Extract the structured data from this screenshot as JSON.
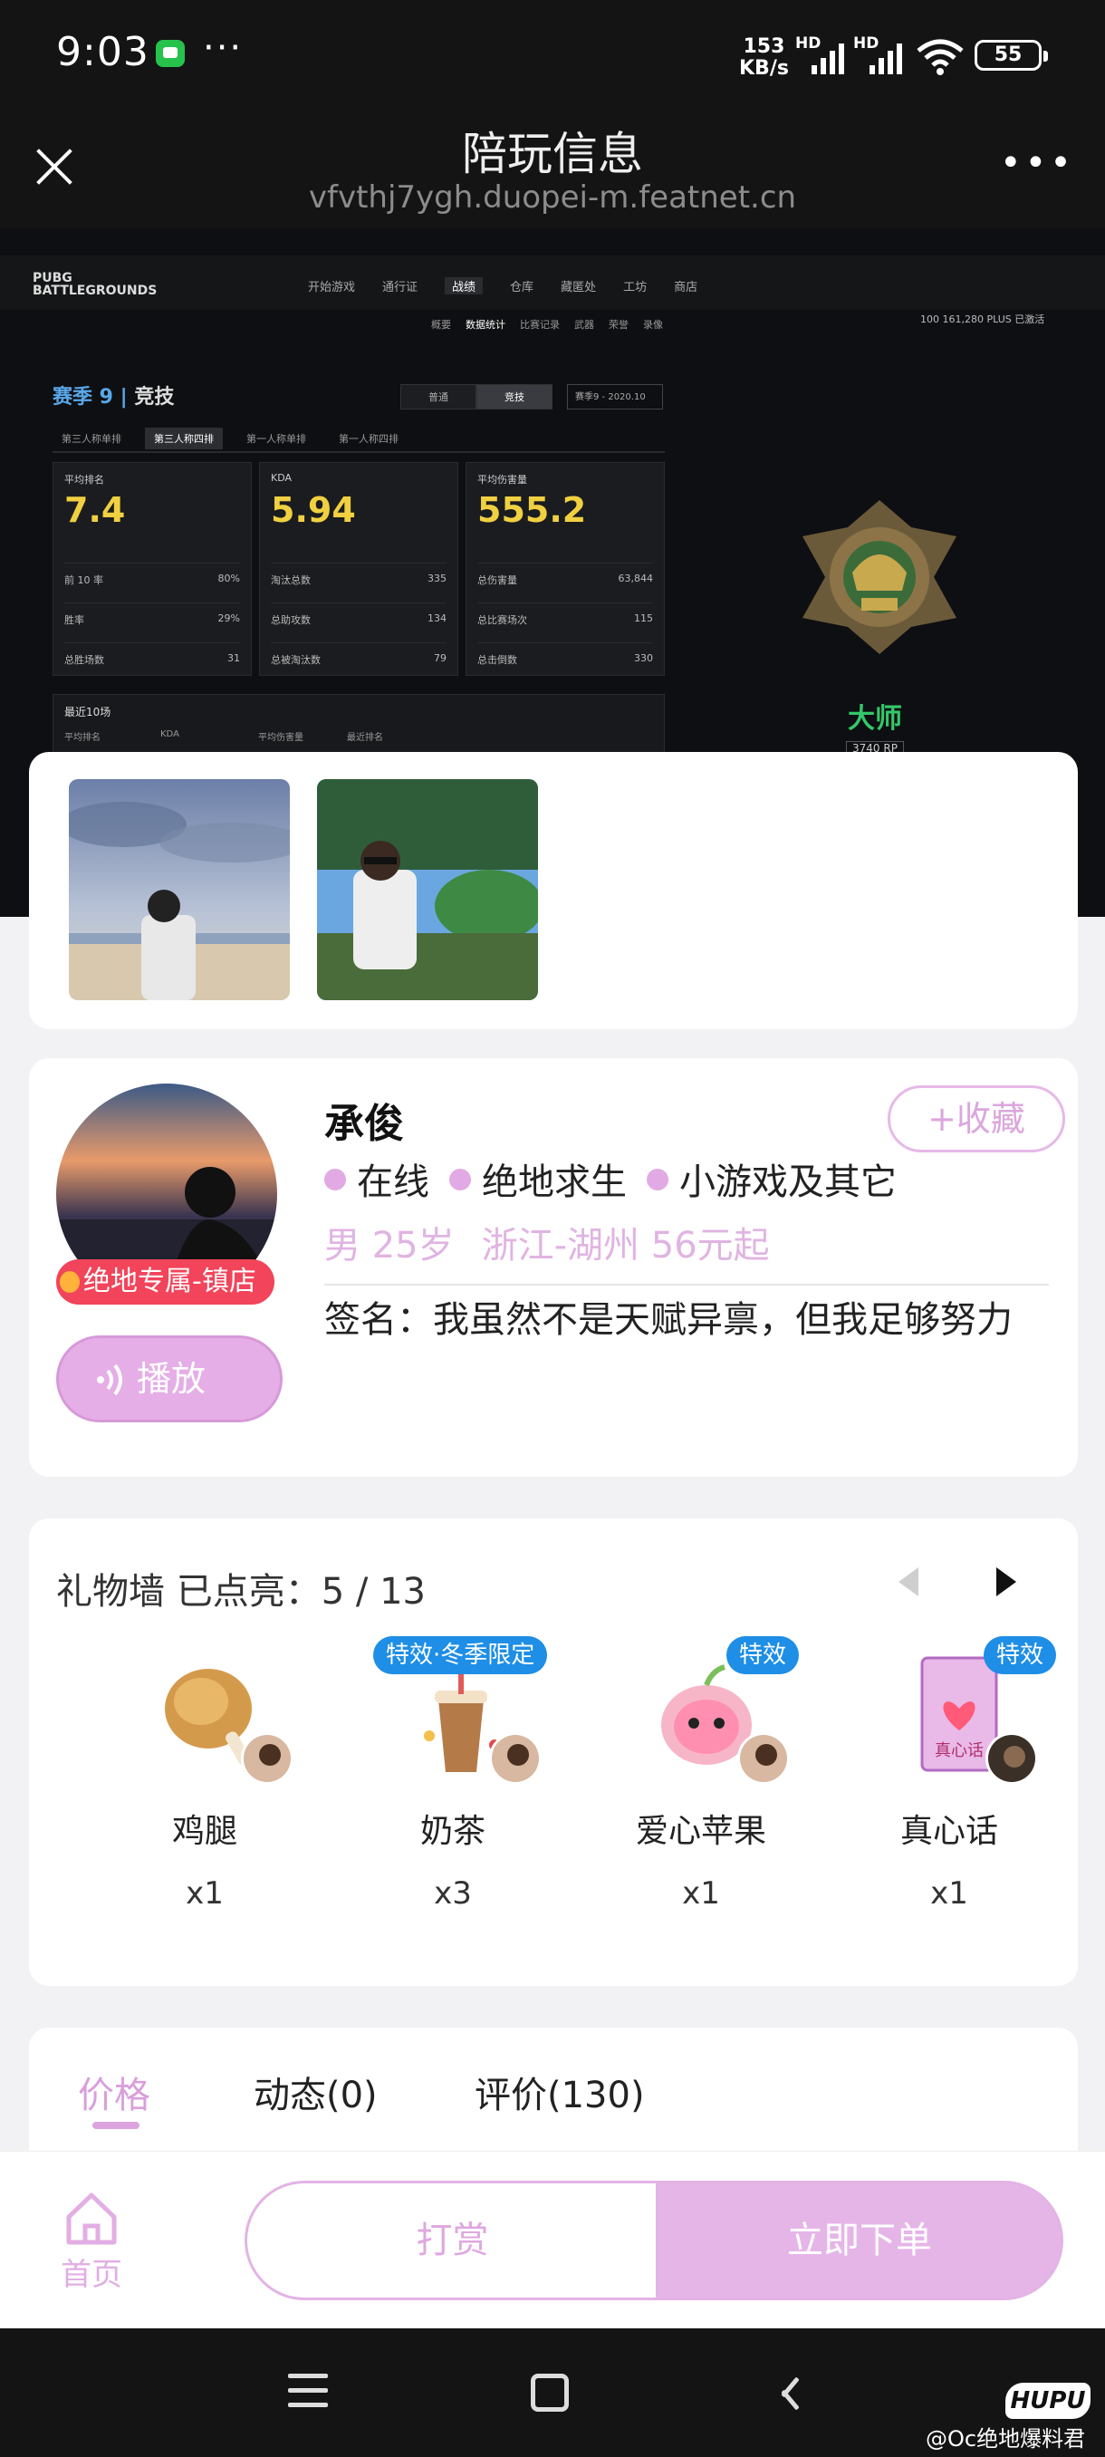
{
  "status_bar": {
    "time": "9:03",
    "net_speed_value": "153",
    "net_speed_unit": "KB/s",
    "signal_label": "HD",
    "battery": "55"
  },
  "header": {
    "title": "陪玩信息",
    "url": "vfvthj7ygh.duopei-m.featnet.cn"
  },
  "banner": {
    "logo_top": "PUBG",
    "logo_bottom": "BATTLEGROUNDS",
    "nav": [
      "开始游戏",
      "通行证",
      "战绩",
      "仓库",
      "藏匿处",
      "工坊",
      "商店"
    ],
    "nav_selected": 2,
    "subnav": [
      "概要",
      "数据统计",
      "比赛记录",
      "武器",
      "荣誉",
      "录像"
    ],
    "subnav_selected": 1,
    "currency": "100   161,280   PLUS   已激活",
    "season": "赛季 9",
    "season_mode": "竞技",
    "mode_normal": "普通",
    "mode_ranked": "竞技",
    "season_select": "赛季9 - 2020.10",
    "perspective_tabs": [
      "第三人称单排",
      "第三人称四排",
      "第一人称单排",
      "第一人称四排"
    ],
    "perspective_selected": 1,
    "cards": [
      {
        "label": "平均排名",
        "value": "7.4",
        "rows": [
          [
            "前 10 率",
            "80%"
          ],
          [
            "胜率",
            "29%"
          ],
          [
            "总胜场数",
            "31"
          ]
        ]
      },
      {
        "label": "KDA",
        "value": "5.94",
        "rows": [
          [
            "淘汰总数",
            "335"
          ],
          [
            "总助攻数",
            "134"
          ],
          [
            "总被淘汰数",
            "79"
          ]
        ]
      },
      {
        "label": "平均伤害量",
        "value": "555.2",
        "rows": [
          [
            "总伤害量",
            "63,844"
          ],
          [
            "总比赛场次",
            "115"
          ],
          [
            "总击倒数",
            "330"
          ]
        ]
      }
    ],
    "recent_title": "最近10场",
    "recent_headers": [
      "平均排名",
      "KDA",
      "平均伤害量",
      "最近排名"
    ],
    "rank_name": "大师",
    "rank_points": "3740",
    "rank_tier": "RP"
  },
  "profile": {
    "name": "承俊",
    "collect_label": "+收藏",
    "badge": "绝地专属-镇店",
    "play_label": "播放",
    "tags": [
      "在线",
      "绝地求生",
      "小游戏及其它"
    ],
    "gender": "男",
    "age": "25岁",
    "location": "浙江-湖州",
    "price": "56元起",
    "signature": "签名：我虽然不是天赋异禀，但我足够努力"
  },
  "gift_wall": {
    "title": "礼物墙 已点亮：5 / 13",
    "items": [
      {
        "name": "鸡腿",
        "count": "x1",
        "tag": ""
      },
      {
        "name": "奶茶",
        "count": "x3",
        "tag": "特效·冬季限定"
      },
      {
        "name": "爱心苹果",
        "count": "x1",
        "tag": "特效"
      },
      {
        "name": "真心话",
        "count": "x1",
        "tag": "特效",
        "card_text": "真心话"
      }
    ]
  },
  "tabs": {
    "items": [
      "价格",
      "动态(0)",
      "评价(130)"
    ],
    "active": 0
  },
  "action_bar": {
    "home_label": "首页",
    "tip_label": "打赏",
    "order_label": "立即下单"
  },
  "footer": {
    "hupu_logo": "HUPU",
    "watermark": "@Oc绝地爆料君"
  },
  "colors": {
    "accent": "#e2aae4",
    "badge_red": "#f2445a",
    "effect_blue": "#1e8ee6",
    "rank_green": "#33c86a",
    "stat_yellow": "#f0d040"
  }
}
